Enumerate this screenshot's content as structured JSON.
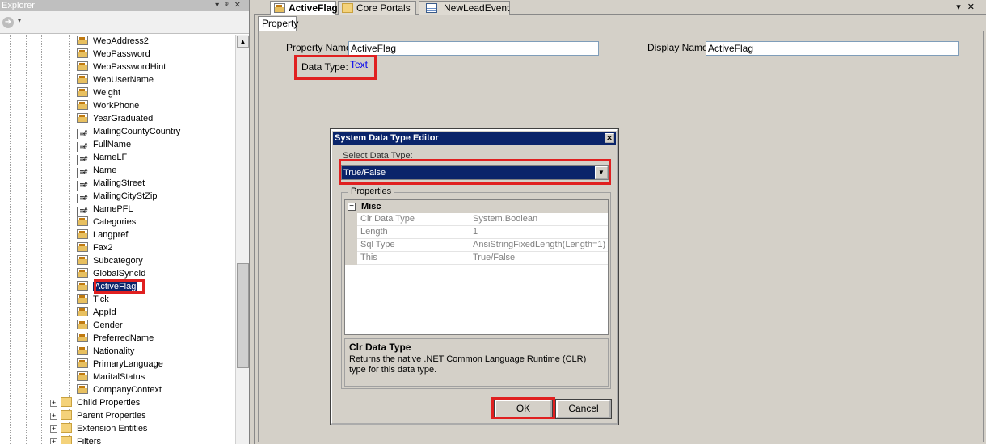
{
  "explorer": {
    "title": "Explorer",
    "items": [
      {
        "label": "WebAddress2",
        "icon": "property-icon"
      },
      {
        "label": "WebPassword",
        "icon": "property-icon"
      },
      {
        "label": "WebPasswordHint",
        "icon": "property-icon"
      },
      {
        "label": "WebUserName",
        "icon": "property-icon"
      },
      {
        "label": "Weight",
        "icon": "property-icon"
      },
      {
        "label": "WorkPhone",
        "icon": "property-icon"
      },
      {
        "label": "YearGraduated",
        "icon": "property-icon"
      },
      {
        "label": "MailingCountyCountry",
        "icon": "calculated-property-icon"
      },
      {
        "label": "FullName",
        "icon": "calculated-property-icon"
      },
      {
        "label": "NameLF",
        "icon": "calculated-property-icon"
      },
      {
        "label": "Name",
        "icon": "calculated-property-icon"
      },
      {
        "label": "MailingStreet",
        "icon": "calculated-property-icon"
      },
      {
        "label": "MailingCityStZip",
        "icon": "calculated-property-icon"
      },
      {
        "label": "NamePFL",
        "icon": "calculated-property-icon"
      },
      {
        "label": "Categories",
        "icon": "property-icon"
      },
      {
        "label": "Langpref",
        "icon": "property-icon"
      },
      {
        "label": "Fax2",
        "icon": "property-icon"
      },
      {
        "label": "Subcategory",
        "icon": "property-icon"
      },
      {
        "label": "GlobalSyncId",
        "icon": "property-icon"
      },
      {
        "label": "ActiveFlag",
        "icon": "property-icon"
      },
      {
        "label": "Tick",
        "icon": "property-icon"
      },
      {
        "label": "AppId",
        "icon": "property-icon"
      },
      {
        "label": "Gender",
        "icon": "property-icon"
      },
      {
        "label": "PreferredName",
        "icon": "property-icon"
      },
      {
        "label": "Nationality",
        "icon": "property-icon"
      },
      {
        "label": "PrimaryLanguage",
        "icon": "property-icon"
      },
      {
        "label": "MaritalStatus",
        "icon": "property-icon"
      },
      {
        "label": "CompanyContext",
        "icon": "property-icon"
      }
    ],
    "folders": [
      {
        "label": "Child Properties",
        "icon": "folder-icon"
      },
      {
        "label": "Parent Properties",
        "icon": "folder-icon"
      },
      {
        "label": "Extension Entities",
        "icon": "folder-icon"
      },
      {
        "label": "Filters",
        "icon": "folder-icon"
      }
    ]
  },
  "tabs": [
    {
      "label": "ActiveFlag",
      "icon": "property-icon"
    },
    {
      "label": "Core Portals",
      "icon": "portal-icon"
    },
    {
      "label": "NewLeadEvent",
      "icon": "event-icon"
    }
  ],
  "property_tab": "Property",
  "form": {
    "property_name_label": "Property Name:",
    "property_name_value": "ActiveFlag",
    "display_name_label": "Display Name:",
    "display_name_value": "ActiveFlag",
    "data_type_label": "Data Type:",
    "data_type_link": "Text"
  },
  "dialog": {
    "title": "System Data Type Editor",
    "select_label": "Select Data Type:",
    "selected_type": "True/False",
    "group_label": "Properties",
    "category": "Misc",
    "rows": [
      {
        "name": "Clr Data Type",
        "value": "System.Boolean"
      },
      {
        "name": "Length",
        "value": "1"
      },
      {
        "name": "Sql Type",
        "value": "AnsiStringFixedLength(Length=1)"
      },
      {
        "name": "This",
        "value": "True/False"
      }
    ],
    "desc_title": "Clr Data Type",
    "desc_body": "Returns the native .NET Common Language Runtime (CLR) type for this data type.",
    "ok_label": "OK",
    "cancel_label": "Cancel"
  },
  "colors": {
    "highlight": "#e02020",
    "selection": "#0a246a",
    "link": "#0000ee"
  }
}
